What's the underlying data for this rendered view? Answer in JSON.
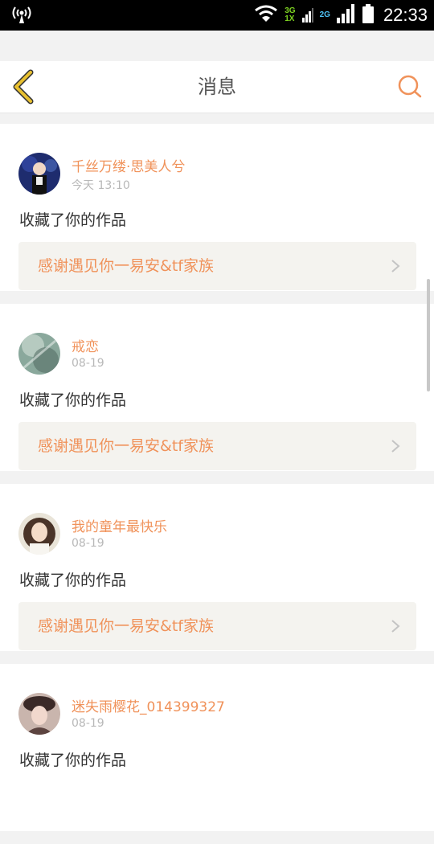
{
  "status_bar": {
    "time": "22:33",
    "net_primary_top": "3G",
    "net_primary_bottom": "1X",
    "net_secondary": "2G",
    "icons": [
      "radio-icon",
      "wifi-icon",
      "signal-icon",
      "battery-icon"
    ]
  },
  "header": {
    "title": "消息",
    "back_icon": "chevron-left-icon",
    "search_icon": "search-icon",
    "accent_color": "#f0925a"
  },
  "colors": {
    "accent": "#f0925a",
    "back_arrow": "#e8c030",
    "card_bg": "#ffffff",
    "page_bg": "#f2f2f2",
    "work_bg": "#f4f3ef"
  },
  "messages": [
    {
      "username": "千丝万缕·思美人兮",
      "time": "今天 13:10",
      "action": "收藏了你的作品",
      "work_title": "感谢遇见你一易安&tf家族"
    },
    {
      "username": "戒恋",
      "time": "08-19",
      "action": "收藏了你的作品",
      "work_title": "感谢遇见你一易安&tf家族"
    },
    {
      "username": "我的童年最快乐",
      "time": "08-19",
      "action": "收藏了你的作品",
      "work_title": "感谢遇见你一易安&tf家族"
    },
    {
      "username": "迷失雨樱花_014399327",
      "time": "08-19",
      "action": "收藏了你的作品",
      "work_title": ""
    }
  ]
}
